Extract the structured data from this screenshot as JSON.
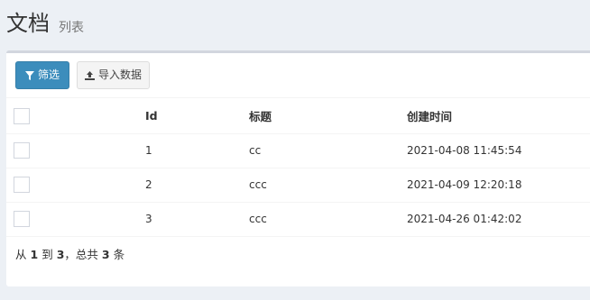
{
  "header": {
    "title": "文档",
    "subtitle": "列表"
  },
  "toolbar": {
    "filter_label": "筛选",
    "import_label": "导入数据"
  },
  "table": {
    "columns": [
      "Id",
      "标题",
      "创建时间"
    ],
    "rows": [
      {
        "id": "1",
        "title": "cc",
        "created": "2021-04-08 11:45:54"
      },
      {
        "id": "2",
        "title": "ccc",
        "created": "2021-04-09 12:20:18"
      },
      {
        "id": "3",
        "title": "ccc",
        "created": "2021-04-26 01:42:02"
      }
    ]
  },
  "pagination": {
    "prefix": "从",
    "from": "1",
    "to_word": "到",
    "to": "3",
    "total_word": "，总共",
    "total": "3",
    "unit": "条"
  },
  "icons": {
    "filter": "filter-icon",
    "import": "upload-icon"
  },
  "colors": {
    "primary": "#3c8dbc",
    "background": "#ecf0f5"
  }
}
